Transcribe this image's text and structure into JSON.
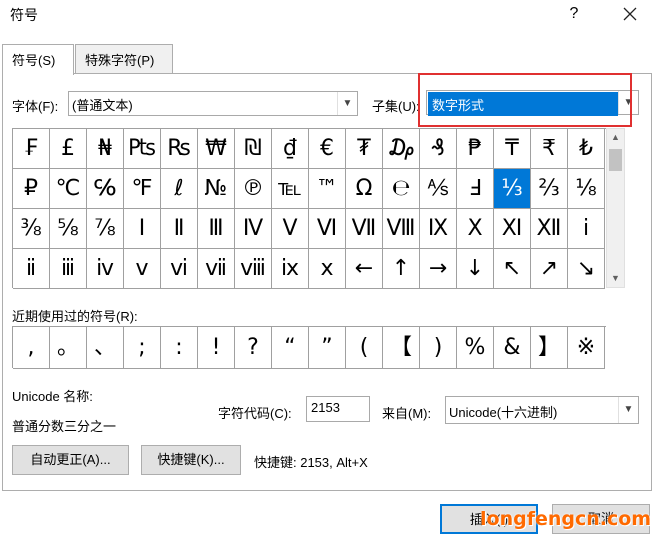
{
  "window": {
    "title": "符号",
    "help": "?",
    "close_icon": "close-icon"
  },
  "tabs": [
    {
      "label": "符号(S)"
    },
    {
      "label": "特殊字符(P)"
    }
  ],
  "font": {
    "label": "字体(F):",
    "value": "(普通文本)"
  },
  "subset": {
    "label": "子集(U):",
    "value": "数字形式"
  },
  "symbols": [
    [
      "₣",
      "£",
      "₦",
      "₧",
      "₨",
      "₩",
      "₪",
      "₫",
      "€",
      "₮",
      "₯",
      "₰",
      "₱",
      "₸",
      "₹",
      "₺"
    ],
    [
      "₽",
      "℃",
      "℅",
      "℉",
      "ℓ",
      "№",
      "℗",
      "℡",
      "™",
      "Ω",
      "℮",
      "⅍",
      "Ⅎ",
      "⅓",
      "⅔",
      "⅛"
    ],
    [
      "⅜",
      "⅝",
      "⅞",
      "Ⅰ",
      "Ⅱ",
      "Ⅲ",
      "Ⅳ",
      "Ⅴ",
      "Ⅵ",
      "Ⅶ",
      "Ⅷ",
      "Ⅸ",
      "Ⅹ",
      "Ⅺ",
      "Ⅻ",
      "ⅰ"
    ],
    [
      "ⅱ",
      "ⅲ",
      "ⅳ",
      "ⅴ",
      "ⅵ",
      "ⅶ",
      "ⅷ",
      "ⅸ",
      "ⅹ",
      "←",
      "↑",
      "→",
      "↓",
      "↖",
      "↗",
      "↘"
    ]
  ],
  "selected_symbol": "⅓",
  "recent": {
    "label": "近期使用过的符号(R):",
    "items": [
      ",",
      "。",
      "、",
      ";",
      ":",
      "!",
      "?",
      "“",
      "”",
      "(",
      "【",
      ")",
      "%",
      "&",
      "】",
      "※"
    ]
  },
  "unicode_name": {
    "label": "Unicode 名称:",
    "value": "普通分数三分之一"
  },
  "char_code": {
    "label": "字符代码(C):",
    "value": "2153"
  },
  "from": {
    "label": "来自(M):",
    "value": "Unicode(十六进制)"
  },
  "buttons": {
    "autocorrect": "自动更正(A)...",
    "shortcut": "快捷键(K)...",
    "shortcut_info": "快捷键: 2153, Alt+X",
    "insert": "插入(I)",
    "cancel": "取消"
  },
  "watermark": "longfengcn.com"
}
